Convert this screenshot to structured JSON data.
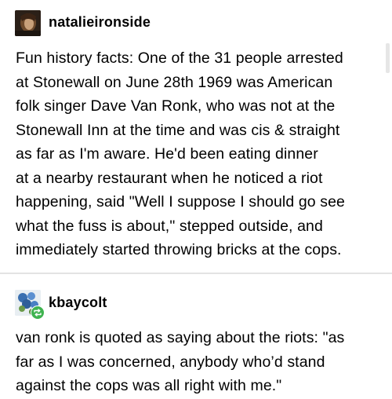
{
  "posts": [
    {
      "username": "natalieironside",
      "avatar_icon": "profile-photo-avatar",
      "lines": [
        "Fun history facts:  One of the 31 people arrested",
        "at Stonewall on June 28th 1969 was American",
        "folk singer Dave Van Ronk, who was not at the",
        "Stonewall Inn at the time and was cis & straight",
        "as far as I'm aware. He'd been eating dinner",
        "at a nearby restaurant when he noticed a riot",
        "happening, said \"Well I suppose I should go see",
        "what the fuss is about,\" stepped outside, and",
        "immediately started throwing bricks at the cops."
      ]
    },
    {
      "username": "kbaycolt",
      "avatar_icon": "flowers-avatar",
      "badge_icon": "reblog-icon",
      "badge_color": "#3fb34f",
      "lines": [
        "van ronk is quoted as saying about the riots: \"as",
        "far as I was concerned, anybody who’d stand",
        "against the cops was all right with me.\""
      ]
    }
  ]
}
